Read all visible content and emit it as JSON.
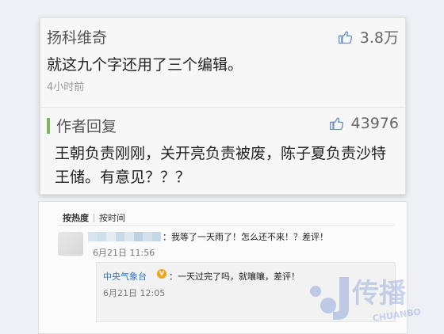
{
  "top_comment": {
    "username": "扬科维奇",
    "likes": "3.8万",
    "text": "就这九个字还用了三个编辑。",
    "time": "4小时前"
  },
  "author_reply": {
    "label": "作者回复",
    "likes": "43976",
    "text": "王朝负责刚刚，关开亮负责被废，陈子夏负责沙特王储。有意见？？？"
  },
  "weibo": {
    "tabs": [
      "按热度",
      "按时间"
    ],
    "active_tab": "按热度",
    "comment": {
      "text": "：我等了一天雨了！怎么还不来！？差评！",
      "time": "6月21日 11:56"
    },
    "reply": {
      "name": "中央气象台",
      "verified_badge": "V",
      "text": "：一天过完了吗，就嚷嚷，差评！",
      "time": "6月21日 12:05"
    }
  },
  "watermark": {
    "brand_cn": "传播",
    "brand_en": "CHUANBO"
  },
  "colors": {
    "author_bar": "#7bb55d",
    "link_blue": "#2e72c6",
    "verified_badge": "#f2a417",
    "watermark": "#3c66c4"
  }
}
